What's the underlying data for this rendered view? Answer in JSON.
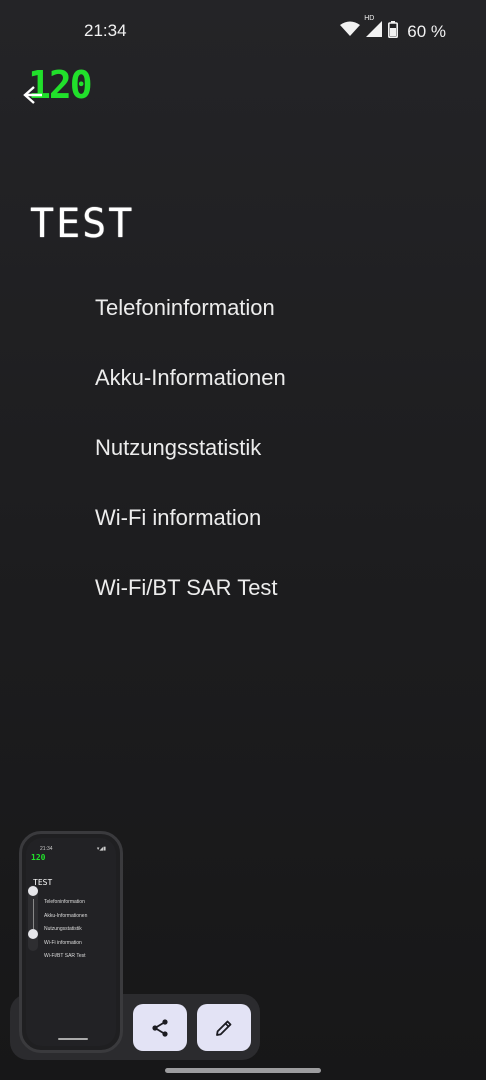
{
  "status_bar": {
    "time": "21:34",
    "network_label": "HD",
    "battery_percent": "60 %",
    "icons": [
      "wifi-icon",
      "cell-signal-icon",
      "battery-icon"
    ]
  },
  "overlay": {
    "fps": "120",
    "accent_color": "#21e02b"
  },
  "page": {
    "title": "TEST",
    "back_icon": "back-arrow-icon"
  },
  "menu": {
    "items": [
      {
        "label": "Telefoninformation"
      },
      {
        "label": "Akku-Informationen"
      },
      {
        "label": "Nutzungsstatistik"
      },
      {
        "label": "Wi-Fi information"
      },
      {
        "label": "Wi-Fi/BT SAR Test"
      }
    ]
  },
  "screenshot_preview": {
    "time": "21:34",
    "fps": "120",
    "title": "TEST",
    "items": [
      "Telefoninformation",
      "Akku-Informationen",
      "Nutzungsstatistik",
      "Wi-Fi information",
      "Wi-Fi/BT SAR Test"
    ]
  },
  "actions": {
    "share_icon": "share-icon",
    "edit_icon": "pencil-icon",
    "button_color": "#e3e3f5"
  }
}
